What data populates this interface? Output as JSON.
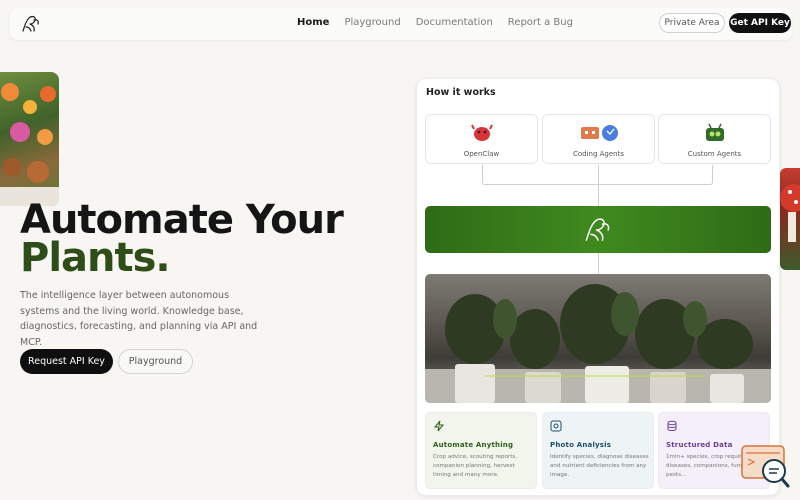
{
  "nav": {
    "links": [
      "Home",
      "Playground",
      "Documentation",
      "Report a Bug"
    ],
    "private_area": "Private Area",
    "get_api_key": "Get API Key"
  },
  "hero": {
    "title_line1": "Automate Your",
    "title_line2": "Plants.",
    "description": "The intelligence layer between autonomous systems and the living world. Knowledge base, diagnostics, forecasting, and planning via API and MCP.",
    "request_button": "Request API Key",
    "playground_button": "Playground"
  },
  "how_it_works": {
    "title": "How it works",
    "agents": [
      "OpenClaw",
      "Coding Agents",
      "Custom Agents"
    ],
    "features": [
      {
        "title": "Automate Anything",
        "desc": "Crop advice, scouting reports, companion planning, harvest timing and many more.",
        "color": "#2e5d1c"
      },
      {
        "title": "Photo Analysis",
        "desc": "Identify species, diagnose diseases and nutrient deficiencies from any image.",
        "color": "#1f4d6b"
      },
      {
        "title": "Structured Data",
        "desc": "1mln+ species, crop requirements, diseases, companions, fungi, pests...",
        "color": "#6b3fa0"
      }
    ]
  },
  "colors": {
    "brand_green": "#2e4d18",
    "accent_bar": "#3f8a1f"
  }
}
